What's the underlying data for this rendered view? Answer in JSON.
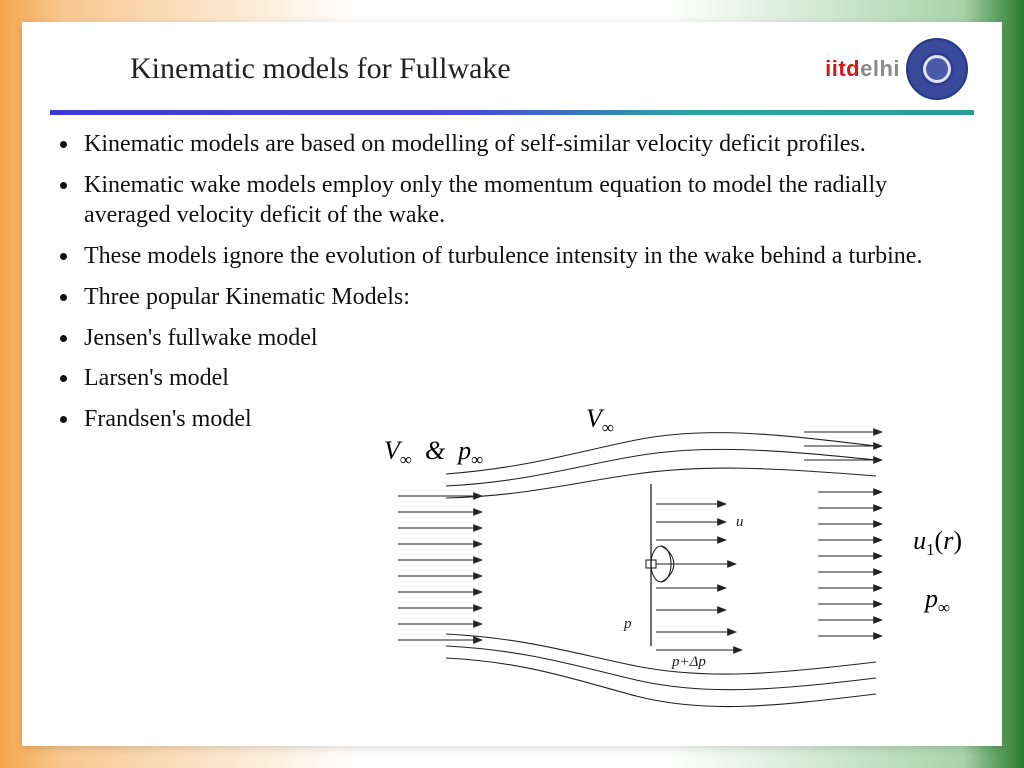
{
  "title": "Kinematic models for Fullwake",
  "logo": {
    "text_red": "iitd",
    "text_gray": "elhi"
  },
  "bullets": [
    "Kinematic models are based on modelling of self-similar velocity deficit profiles.",
    " Kinematic wake models employ only the momentum equation to model the radially averaged velocity deficit of the wake.",
    "These models ignore the evolution of turbulence intensity in the wake behind a turbine.",
    "Three popular Kinematic Models:",
    "Jensen's fullwake model",
    "Larsen's model",
    "Frandsen's model"
  ],
  "diagram": {
    "V_inf_top": "V",
    "V_and_p_inf": "V∞ & p∞",
    "u1_r": "u₁(r)",
    "p_inf_right": "p∞",
    "u_small": "u",
    "p_small": "p",
    "p_dp_small": "p+Δp"
  }
}
